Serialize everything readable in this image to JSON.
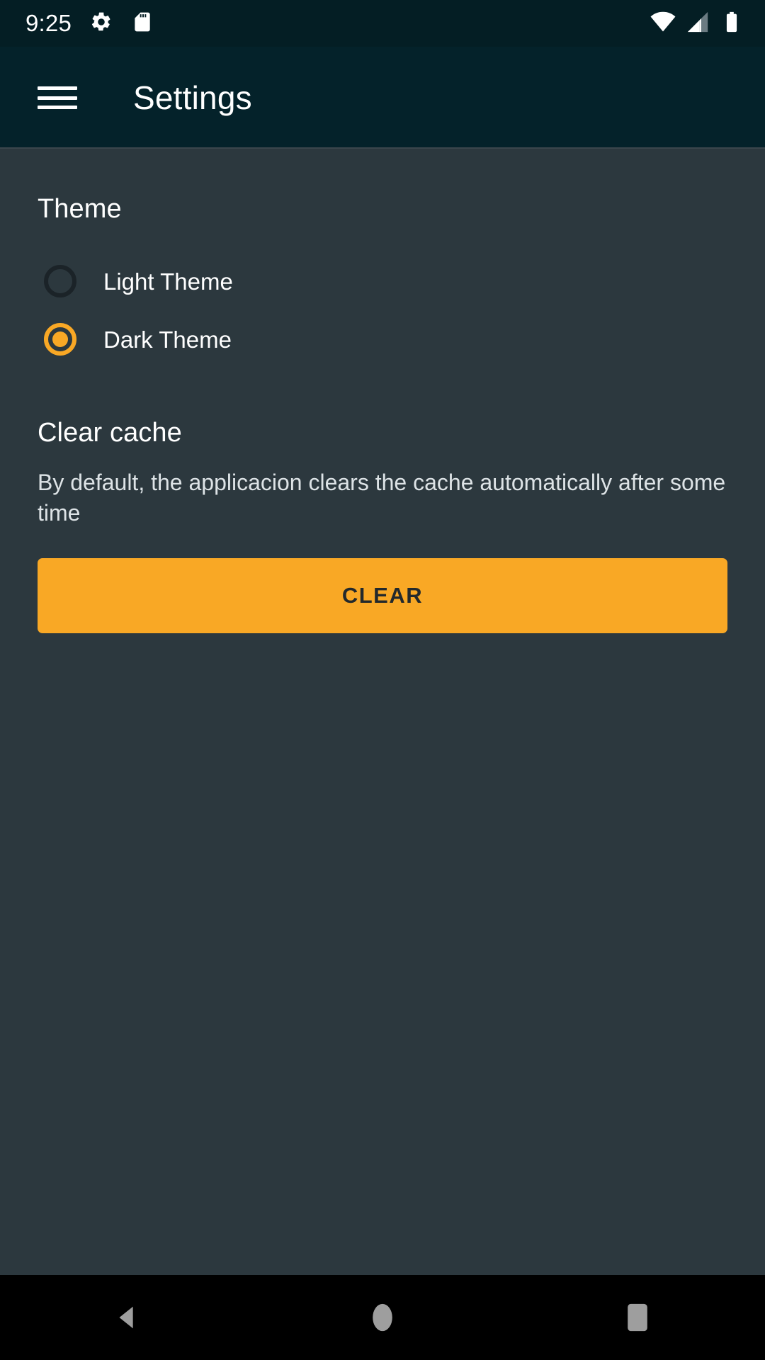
{
  "status_bar": {
    "clock": "9:25",
    "left_icons": [
      {
        "name": "settings-gear-icon"
      },
      {
        "name": "sd-card-icon"
      }
    ],
    "right_icons": [
      {
        "name": "wifi-icon"
      },
      {
        "name": "cellular-signal-icon"
      },
      {
        "name": "battery-icon"
      }
    ]
  },
  "app_bar": {
    "menu_icon": "hamburger-menu-icon",
    "title": "Settings"
  },
  "theme_section": {
    "heading": "Theme",
    "options": [
      {
        "label": "Light Theme",
        "selected": false
      },
      {
        "label": "Dark Theme",
        "selected": true
      }
    ]
  },
  "cache_section": {
    "heading": "Clear cache",
    "description": "By default, the applicacion clears the cache automatically after some time",
    "button_label": "CLEAR"
  },
  "nav_bar": {
    "back_label": "Back",
    "home_label": "Home",
    "recents_label": "Recents"
  },
  "colors": {
    "accent": "#f9a825",
    "app_bar_bg": "#04222a",
    "status_bar_bg": "#041e24",
    "content_bg": "#2c383e",
    "nav_bar_bg": "#000000",
    "primary_text": "#ffffff",
    "secondary_text": "#dde3e6",
    "button_text": "#23292c"
  }
}
